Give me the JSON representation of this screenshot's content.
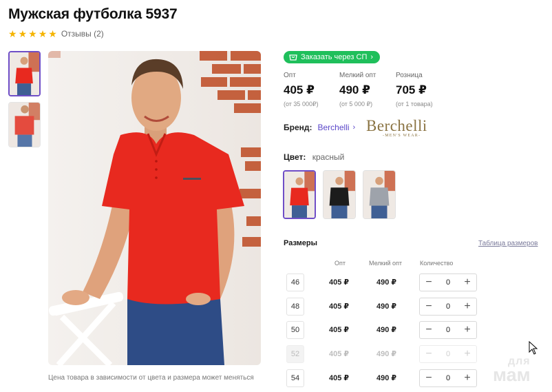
{
  "product": {
    "title": "Мужская футболка 5937",
    "rating": 5,
    "reviews_label": "Отзывы (2)"
  },
  "gallery": {
    "thumbnails": [
      {
        "shirt_color": "#e8291f",
        "active": true
      },
      {
        "shirt_color": "#e8291f",
        "active": false
      }
    ],
    "caption": "Цена товара в зависимости от цвета и размера может меняться"
  },
  "order_button": {
    "label": "Заказать через СП",
    "color": "#1fbf5b"
  },
  "prices": [
    {
      "label": "Опт",
      "value": "405 ₽",
      "note": "(от 35 000₽)"
    },
    {
      "label": "Мелкий опт",
      "value": "490 ₽",
      "note": "(от 5 000 ₽)"
    },
    {
      "label": "Розница",
      "value": "705 ₽",
      "note": "(от 1 товара)"
    }
  ],
  "brand": {
    "label": "Бренд:",
    "name": "Berchelli",
    "logo_text": "Berchelli",
    "logo_sub": "-MEN'S WEAR-"
  },
  "color": {
    "label": "Цвет:",
    "value": "красный",
    "swatches": [
      {
        "shirt_color": "#e8291f",
        "active": true
      },
      {
        "shirt_color": "#1c1c1c",
        "active": false
      },
      {
        "shirt_color": "#9ea3ab",
        "active": false
      }
    ]
  },
  "sizes": {
    "title": "Размеры",
    "table_link": "Таблица размеров",
    "headers": {
      "opt": "Опт",
      "small_opt": "Мелкий опт",
      "qty": "Количество"
    },
    "rows": [
      {
        "size": "46",
        "opt": "405 ₽",
        "small_opt": "490 ₽",
        "qty": "0",
        "available": true
      },
      {
        "size": "48",
        "opt": "405 ₽",
        "small_opt": "490 ₽",
        "qty": "0",
        "available": true
      },
      {
        "size": "50",
        "opt": "405 ₽",
        "small_opt": "490 ₽",
        "qty": "0",
        "available": true
      },
      {
        "size": "52",
        "opt": "405 ₽",
        "small_opt": "490 ₽",
        "qty": "0",
        "available": false
      },
      {
        "size": "54",
        "opt": "405 ₽",
        "small_opt": "490 ₽",
        "qty": "0",
        "available": true
      }
    ]
  },
  "watermark": {
    "line1": "для",
    "line2": "мам"
  },
  "colors": {
    "accent": "#6f4ec7",
    "link": "#5a46c9",
    "star": "#f5b400",
    "shirt_red": "#e8291f"
  }
}
